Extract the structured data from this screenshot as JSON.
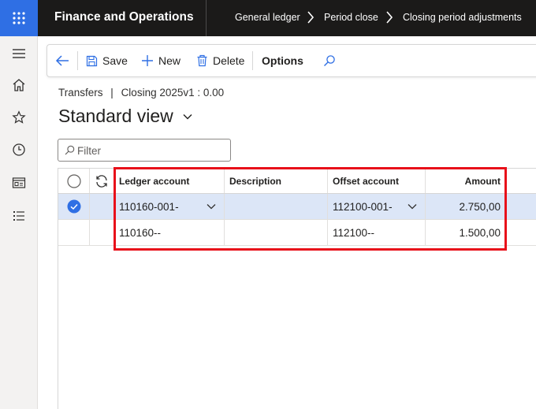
{
  "topbar": {
    "app_title": "Finance and Operations",
    "breadcrumbs": [
      "General ledger",
      "Period close",
      "Closing period adjustments"
    ]
  },
  "leftnav": {
    "items": [
      "menu-icon",
      "home-icon",
      "star-icon",
      "clock-icon",
      "workspace-icon",
      "list-icon"
    ]
  },
  "actions": {
    "save": "Save",
    "new": "New",
    "delete": "Delete",
    "options": "Options"
  },
  "page": {
    "caption_left": "Transfers",
    "caption_sep": "|",
    "caption_right": "Closing 2025v1 : 0.00",
    "view_title": "Standard view"
  },
  "filter": {
    "placeholder": "Filter"
  },
  "grid": {
    "columns": [
      "Ledger account",
      "Description",
      "Offset account",
      "Amount"
    ],
    "rows": [
      {
        "selected": true,
        "ledger": "110160-001-",
        "description": "",
        "offset": "112100-001-",
        "amount": "2.750,00"
      },
      {
        "selected": false,
        "ledger": "110160--",
        "description": "",
        "offset": "112100--",
        "amount": "1.500,00"
      }
    ]
  },
  "colors": {
    "accent": "#2f6fe4",
    "topbar": "#1b1a19",
    "selected_row": "#dce6f7",
    "highlight": "#e8101a"
  }
}
